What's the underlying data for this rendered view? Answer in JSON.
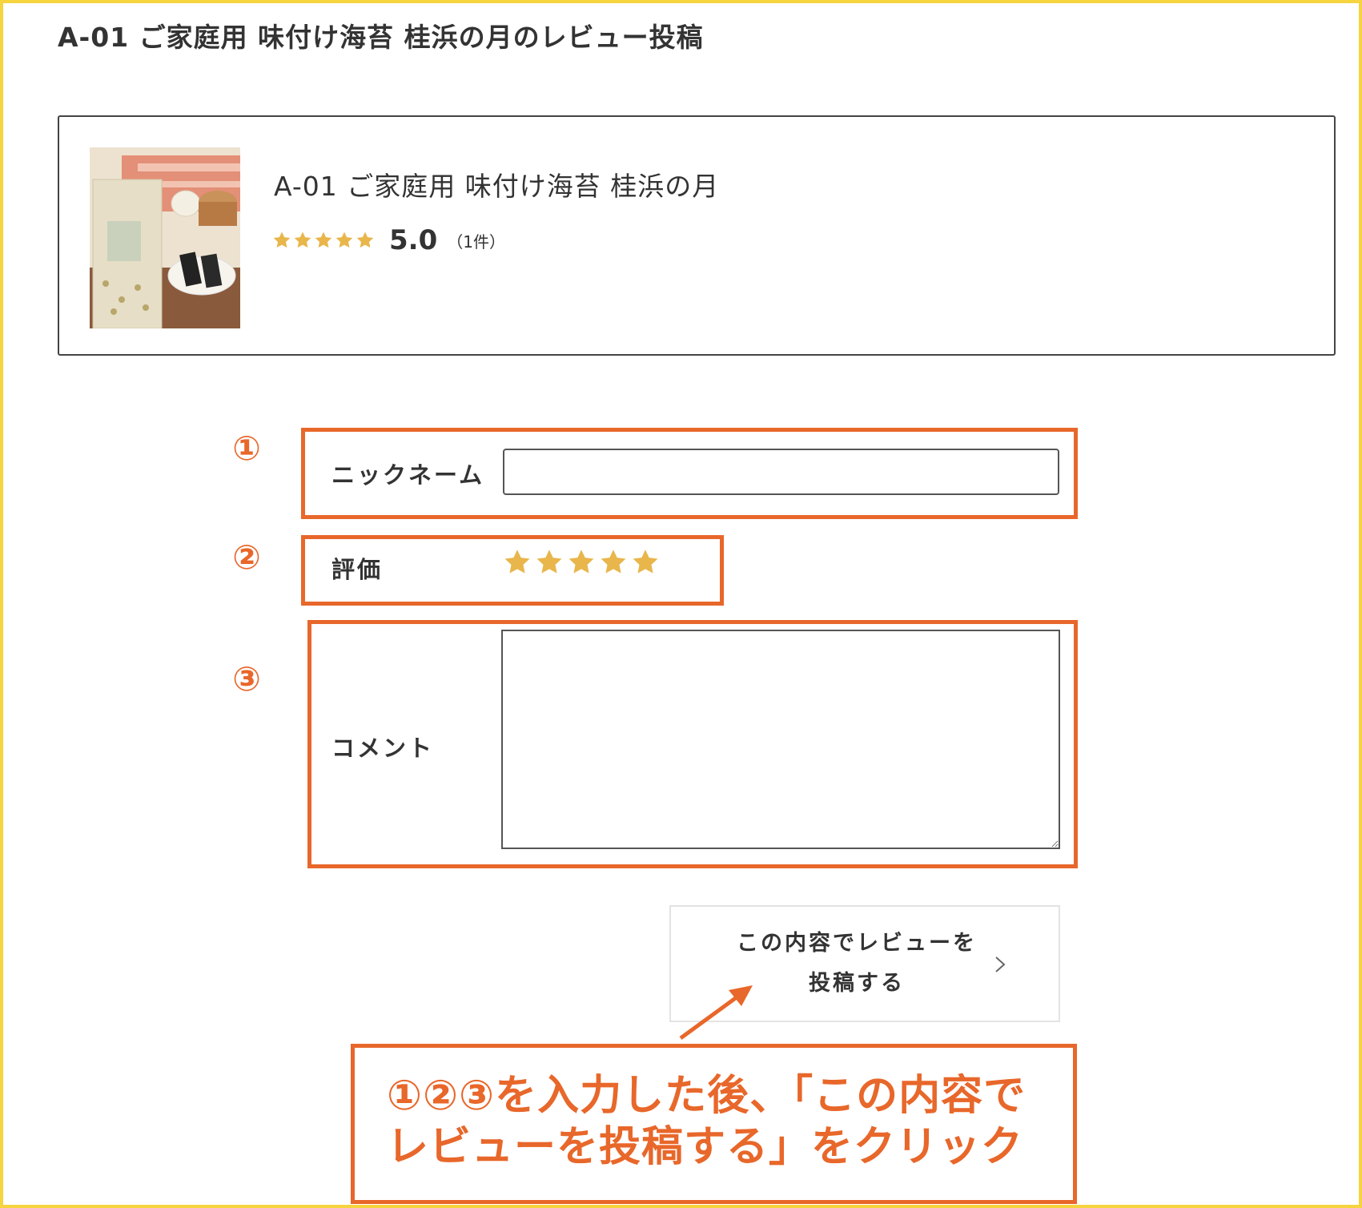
{
  "page": {
    "title": "A-01 ご家庭用 味付け海苔 桂浜の月のレビュー投稿"
  },
  "product": {
    "name": "A-01 ご家庭用 味付け海苔 桂浜の月",
    "rating_stars": 5,
    "rating_score": "5.0",
    "review_count": "（1件）",
    "image_icon": "product-photo"
  },
  "form": {
    "nickname": {
      "step": "①",
      "label": "ニックネーム",
      "value": "",
      "placeholder": ""
    },
    "rating": {
      "step": "②",
      "label": "評価",
      "selected_stars": 5,
      "max_stars": 5
    },
    "comment": {
      "step": "③",
      "label": "コメント",
      "value": ""
    },
    "submit": {
      "line1": "この内容でレビューを",
      "line2": "投稿する",
      "icon": "chevron-right-icon"
    }
  },
  "annotation": {
    "line1": "①②③を入力した後、「この内容で",
    "line2": "レビューを投稿する」をクリック"
  },
  "colors": {
    "frame": "#f5d43f",
    "highlight": "#e8672a",
    "star": "#e8b64b"
  }
}
